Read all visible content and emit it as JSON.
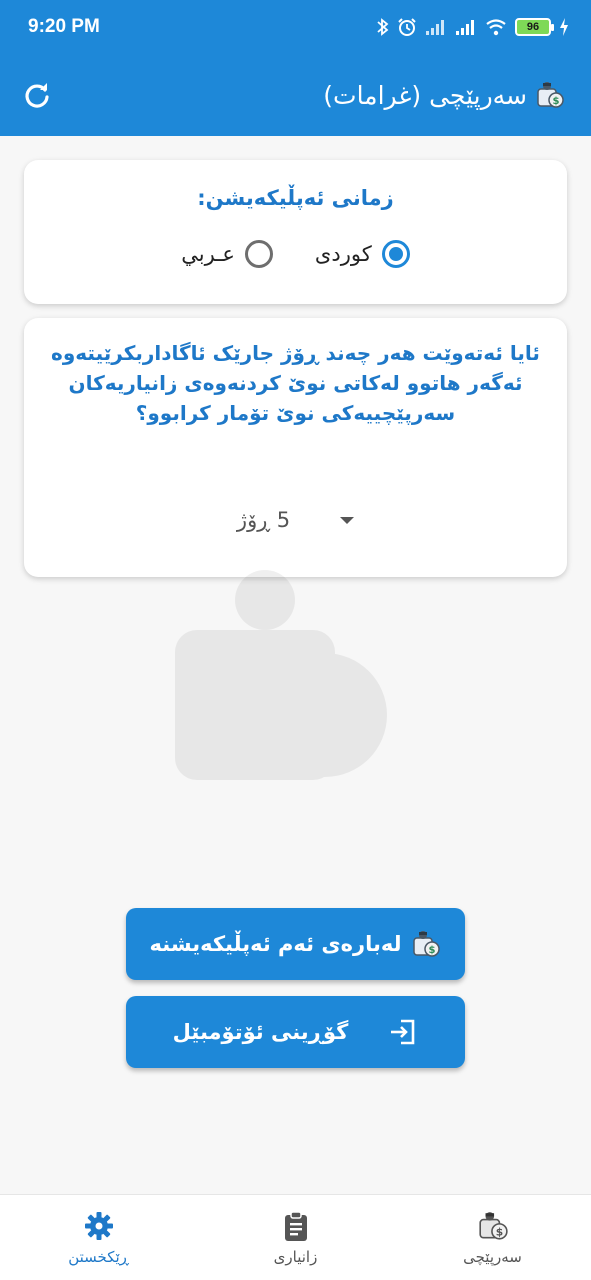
{
  "status_bar": {
    "time": "9:20 PM",
    "battery": "96"
  },
  "app_bar": {
    "title": "سەرپێچی (غرامات)",
    "refresh_icon": "refresh-icon",
    "logo_icon": "app-logo-icon"
  },
  "language_card": {
    "title": "زمانی ئەپڵیکەیشن:",
    "options": [
      {
        "label": "كوردی",
        "checked": true
      },
      {
        "label": "عـربي",
        "checked": false
      }
    ]
  },
  "reminder_card": {
    "question": "ئایا ئەتەوێت هەر چەند ڕۆژ جارێک ئاگاداربکرێیتەوە ئەگەر هاتوو لەکاتی نوێ کردنەوەی زانیاریەکان سەرپێچییەکی نوێ تۆمار کرابوو؟",
    "selected_days": "5 ڕۆژ"
  },
  "buttons": {
    "about_label": "لەبارەی ئەم ئەپڵیکەیشنە",
    "change_car_label": "گۆڕینی ئۆتۆمبێل"
  },
  "bottom_nav": {
    "items": [
      {
        "label": "ڕێکخستن",
        "icon": "gear-icon",
        "active": true
      },
      {
        "label": "زانیاری",
        "icon": "clipboard-icon",
        "active": false
      },
      {
        "label": "سەرپێچی",
        "icon": "app-logo-icon",
        "active": false
      }
    ]
  },
  "colors": {
    "primary": "#1e88d8",
    "accent_text": "#1e78c8"
  }
}
